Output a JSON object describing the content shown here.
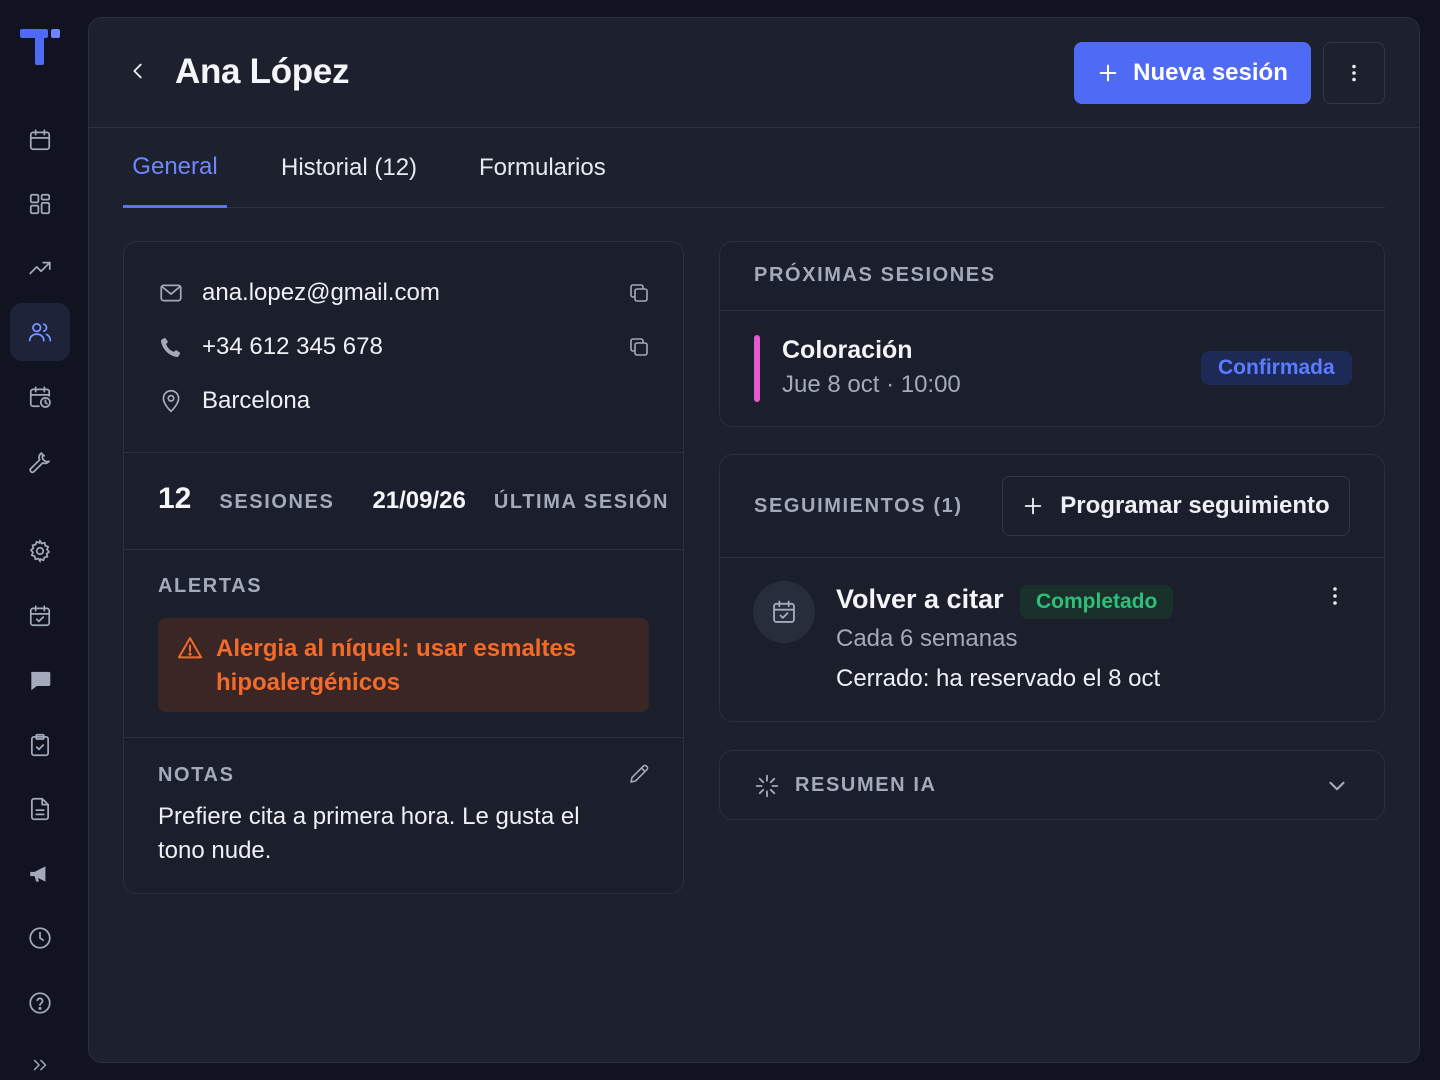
{
  "sidebar": {
    "logo": "t-logo",
    "items": [
      {
        "icon": "calendar-icon",
        "label": "Calendario"
      },
      {
        "icon": "dashboard-icon",
        "label": "Panel"
      },
      {
        "icon": "trending-up-icon",
        "label": "Estadísticas"
      },
      {
        "icon": "users-icon",
        "label": "Clientes",
        "active": true
      },
      {
        "icon": "calendar-clock-icon",
        "label": "Agenda"
      },
      {
        "icon": "wrench-icon",
        "label": "Herramientas"
      },
      {
        "icon": "gear-icon",
        "label": "Ajustes"
      },
      {
        "icon": "calendar-check-icon",
        "label": "Reservas"
      },
      {
        "icon": "chat-icon",
        "label": "Mensajes"
      },
      {
        "icon": "clipboard-check-icon",
        "label": "Tareas"
      },
      {
        "icon": "document-icon",
        "label": "Documentos"
      },
      {
        "icon": "megaphone-icon",
        "label": "Marketing"
      },
      {
        "icon": "clock-icon",
        "label": "Historial"
      },
      {
        "icon": "help-icon",
        "label": "Ayuda"
      },
      {
        "icon": "expand-icon",
        "label": "Expandir"
      }
    ]
  },
  "header": {
    "title": "Ana López",
    "new_session_label": "Nueva sesión"
  },
  "tabs": [
    {
      "label": "General",
      "active": true
    },
    {
      "label": "Historial (12)"
    },
    {
      "label": "Formularios"
    }
  ],
  "contact": {
    "email": "ana.lopez@gmail.com",
    "phone": "+34 612 345 678",
    "city": "Barcelona"
  },
  "stats": {
    "sessions_count": "12",
    "sessions_label": "SESIONES",
    "last_date": "21/09/26",
    "last_label": "ÚLTIMA SESIÓN"
  },
  "alerts": {
    "label": "ALERTAS",
    "items": [
      "Alergia al níquel: usar esmaltes hipoalergénicos"
    ]
  },
  "notes": {
    "label": "NOTAS",
    "text": "Prefiere cita a primera hora. Le gusta el tono nude."
  },
  "upcoming": {
    "label": "PRÓXIMAS SESIONES",
    "sessions": [
      {
        "service": "Coloración",
        "when": "Jue 8 oct · 10:00",
        "status": "Confirmada",
        "color": "#e45bd0"
      }
    ]
  },
  "followups": {
    "label": "SEGUIMIENTOS (1)",
    "program_label": "Programar seguimiento",
    "items": [
      {
        "title": "Volver a citar",
        "status": "Completado",
        "frequency": "Cada 6 semanas",
        "result": "Cerrado: ha reservado el 8 oct"
      }
    ]
  },
  "ai_summary": {
    "label": "RESUMEN IA"
  },
  "colors": {
    "accent": "#4f6af5",
    "alert": "#f26b2a",
    "success": "#2fbf79",
    "session_marker": "#e45bd0"
  }
}
